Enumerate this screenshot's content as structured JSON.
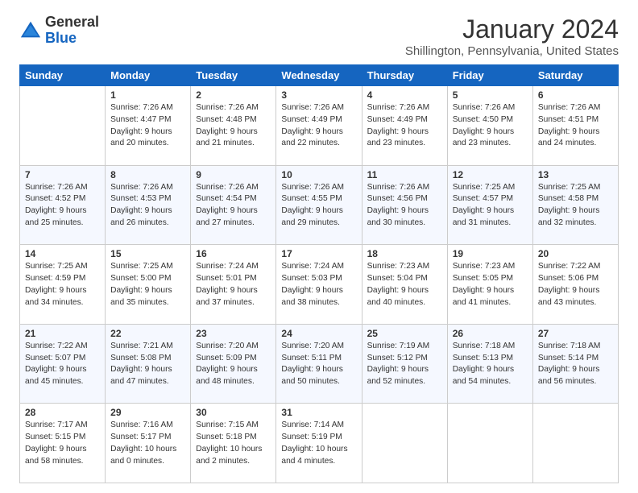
{
  "logo": {
    "general": "General",
    "blue": "Blue"
  },
  "title": "January 2024",
  "subtitle": "Shillington, Pennsylvania, United States",
  "days_of_week": [
    "Sunday",
    "Monday",
    "Tuesday",
    "Wednesday",
    "Thursday",
    "Friday",
    "Saturday"
  ],
  "weeks": [
    [
      {
        "day": "",
        "info": ""
      },
      {
        "day": "1",
        "info": "Sunrise: 7:26 AM\nSunset: 4:47 PM\nDaylight: 9 hours\nand 20 minutes."
      },
      {
        "day": "2",
        "info": "Sunrise: 7:26 AM\nSunset: 4:48 PM\nDaylight: 9 hours\nand 21 minutes."
      },
      {
        "day": "3",
        "info": "Sunrise: 7:26 AM\nSunset: 4:49 PM\nDaylight: 9 hours\nand 22 minutes."
      },
      {
        "day": "4",
        "info": "Sunrise: 7:26 AM\nSunset: 4:49 PM\nDaylight: 9 hours\nand 23 minutes."
      },
      {
        "day": "5",
        "info": "Sunrise: 7:26 AM\nSunset: 4:50 PM\nDaylight: 9 hours\nand 23 minutes."
      },
      {
        "day": "6",
        "info": "Sunrise: 7:26 AM\nSunset: 4:51 PM\nDaylight: 9 hours\nand 24 minutes."
      }
    ],
    [
      {
        "day": "7",
        "info": "Sunrise: 7:26 AM\nSunset: 4:52 PM\nDaylight: 9 hours\nand 25 minutes."
      },
      {
        "day": "8",
        "info": "Sunrise: 7:26 AM\nSunset: 4:53 PM\nDaylight: 9 hours\nand 26 minutes."
      },
      {
        "day": "9",
        "info": "Sunrise: 7:26 AM\nSunset: 4:54 PM\nDaylight: 9 hours\nand 27 minutes."
      },
      {
        "day": "10",
        "info": "Sunrise: 7:26 AM\nSunset: 4:55 PM\nDaylight: 9 hours\nand 29 minutes."
      },
      {
        "day": "11",
        "info": "Sunrise: 7:26 AM\nSunset: 4:56 PM\nDaylight: 9 hours\nand 30 minutes."
      },
      {
        "day": "12",
        "info": "Sunrise: 7:25 AM\nSunset: 4:57 PM\nDaylight: 9 hours\nand 31 minutes."
      },
      {
        "day": "13",
        "info": "Sunrise: 7:25 AM\nSunset: 4:58 PM\nDaylight: 9 hours\nand 32 minutes."
      }
    ],
    [
      {
        "day": "14",
        "info": "Sunrise: 7:25 AM\nSunset: 4:59 PM\nDaylight: 9 hours\nand 34 minutes."
      },
      {
        "day": "15",
        "info": "Sunrise: 7:25 AM\nSunset: 5:00 PM\nDaylight: 9 hours\nand 35 minutes."
      },
      {
        "day": "16",
        "info": "Sunrise: 7:24 AM\nSunset: 5:01 PM\nDaylight: 9 hours\nand 37 minutes."
      },
      {
        "day": "17",
        "info": "Sunrise: 7:24 AM\nSunset: 5:03 PM\nDaylight: 9 hours\nand 38 minutes."
      },
      {
        "day": "18",
        "info": "Sunrise: 7:23 AM\nSunset: 5:04 PM\nDaylight: 9 hours\nand 40 minutes."
      },
      {
        "day": "19",
        "info": "Sunrise: 7:23 AM\nSunset: 5:05 PM\nDaylight: 9 hours\nand 41 minutes."
      },
      {
        "day": "20",
        "info": "Sunrise: 7:22 AM\nSunset: 5:06 PM\nDaylight: 9 hours\nand 43 minutes."
      }
    ],
    [
      {
        "day": "21",
        "info": "Sunrise: 7:22 AM\nSunset: 5:07 PM\nDaylight: 9 hours\nand 45 minutes."
      },
      {
        "day": "22",
        "info": "Sunrise: 7:21 AM\nSunset: 5:08 PM\nDaylight: 9 hours\nand 47 minutes."
      },
      {
        "day": "23",
        "info": "Sunrise: 7:20 AM\nSunset: 5:09 PM\nDaylight: 9 hours\nand 48 minutes."
      },
      {
        "day": "24",
        "info": "Sunrise: 7:20 AM\nSunset: 5:11 PM\nDaylight: 9 hours\nand 50 minutes."
      },
      {
        "day": "25",
        "info": "Sunrise: 7:19 AM\nSunset: 5:12 PM\nDaylight: 9 hours\nand 52 minutes."
      },
      {
        "day": "26",
        "info": "Sunrise: 7:18 AM\nSunset: 5:13 PM\nDaylight: 9 hours\nand 54 minutes."
      },
      {
        "day": "27",
        "info": "Sunrise: 7:18 AM\nSunset: 5:14 PM\nDaylight: 9 hours\nand 56 minutes."
      }
    ],
    [
      {
        "day": "28",
        "info": "Sunrise: 7:17 AM\nSunset: 5:15 PM\nDaylight: 9 hours\nand 58 minutes."
      },
      {
        "day": "29",
        "info": "Sunrise: 7:16 AM\nSunset: 5:17 PM\nDaylight: 10 hours\nand 0 minutes."
      },
      {
        "day": "30",
        "info": "Sunrise: 7:15 AM\nSunset: 5:18 PM\nDaylight: 10 hours\nand 2 minutes."
      },
      {
        "day": "31",
        "info": "Sunrise: 7:14 AM\nSunset: 5:19 PM\nDaylight: 10 hours\nand 4 minutes."
      },
      {
        "day": "",
        "info": ""
      },
      {
        "day": "",
        "info": ""
      },
      {
        "day": "",
        "info": ""
      }
    ]
  ]
}
